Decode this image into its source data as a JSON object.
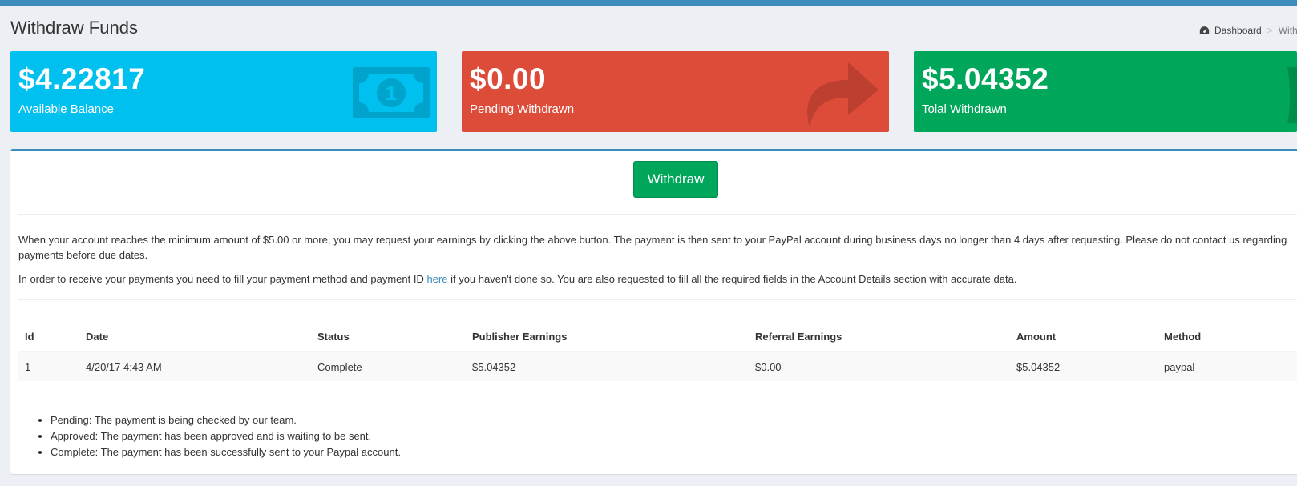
{
  "page": {
    "title": "Withdraw Funds",
    "breadcrumb": {
      "home": "Dashboard",
      "current": "Withd"
    }
  },
  "stats": [
    {
      "value": "$4.22817",
      "label": "Available Balance",
      "icon": "money-bill-icon",
      "color": "#00c0ef"
    },
    {
      "value": "$0.00",
      "label": "Pending Withdrawn",
      "icon": "share-arrow-icon",
      "color": "#dd4b39"
    },
    {
      "value": "$5.04352",
      "label": "Tolal Withdrawn",
      "icon": "partial-icon",
      "color": "#00a65a"
    }
  ],
  "withdraw_button": "Withdraw",
  "info": {
    "paragraph1": "When your account reaches the minimum amount of $5.00 or more, you may request your earnings by clicking the above button. The payment is then sent to your PayPal account during business days no longer than 4 days after requesting. Please do not contact us regarding payments before due dates.",
    "paragraph2_before": "In order to receive your payments you need to fill your payment method and payment ID ",
    "paragraph2_link": "here",
    "paragraph2_after": " if you haven't done so. You are also requested to fill all the required fields in the Account Details section with accurate data."
  },
  "table": {
    "headers": [
      "Id",
      "Date",
      "Status",
      "Publisher Earnings",
      "Referral Earnings",
      "Amount",
      "Method"
    ],
    "rows": [
      [
        "1",
        "4/20/17 4:43 AM",
        "Complete",
        "$5.04352",
        "$0.00",
        "$5.04352",
        "paypal"
      ]
    ]
  },
  "legend": [
    "Pending: The payment is being checked by our team.",
    "Approved: The payment has been approved and is waiting to be sent.",
    "Complete: The payment has been successfully sent to your Paypal account."
  ],
  "colors": {
    "primary": "#3c8dbc",
    "aqua": "#00c0ef",
    "red": "#dd4b39",
    "green": "#00a65a",
    "background": "#ecf0f5"
  }
}
